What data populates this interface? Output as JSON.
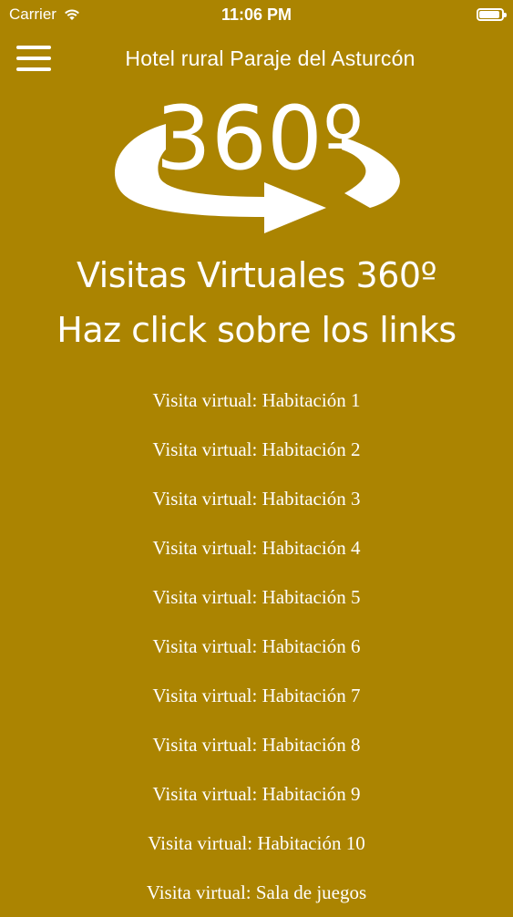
{
  "status_bar": {
    "carrier": "Carrier",
    "time": "11:06 PM",
    "battery_level_percent": 100
  },
  "nav": {
    "title": "Hotel rural Paraje del Asturcón",
    "menu_icon": "hamburger-menu-icon"
  },
  "banner": {
    "logo_text": "360º",
    "logo_icon": "rotate-360-arrow-icon",
    "heading_line1": "Visitas Virtuales 360º",
    "heading_line2": "Haz click sobre los links"
  },
  "links": [
    "Visita virtual: Habitación 1",
    "Visita virtual: Habitación 2",
    "Visita virtual: Habitación 3",
    "Visita virtual: Habitación 4",
    "Visita virtual: Habitación 5",
    "Visita virtual: Habitación 6",
    "Visita virtual: Habitación 7",
    "Visita virtual: Habitación 8",
    "Visita virtual: Habitación 9",
    "Visita virtual: Habitación 10",
    "Visita virtual: Sala de juegos"
  ],
  "colors": {
    "background": "#ab8401",
    "text": "#ffffff"
  }
}
